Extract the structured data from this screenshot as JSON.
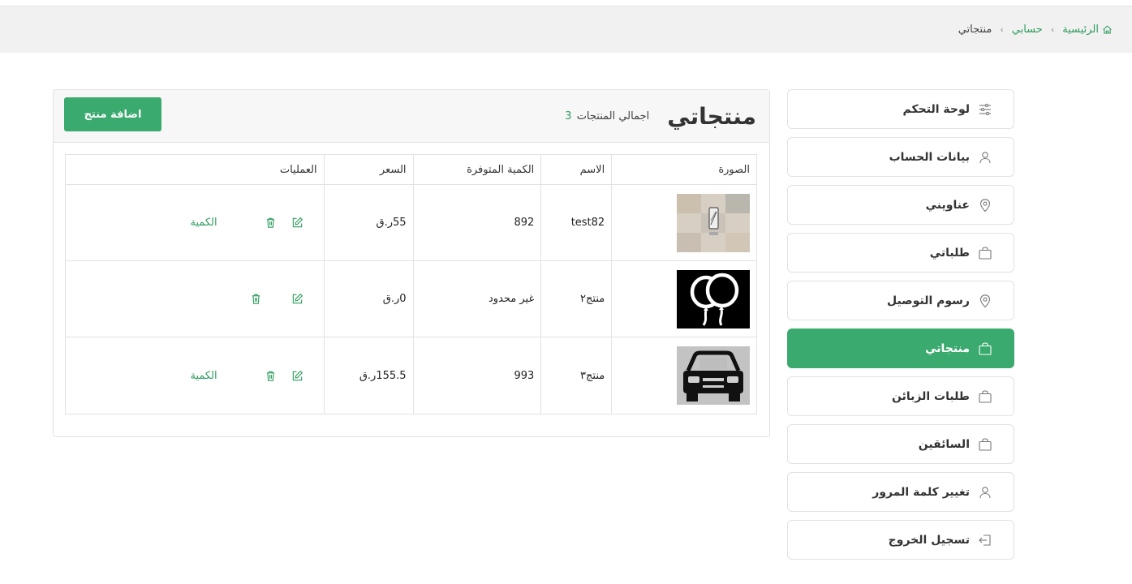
{
  "breadcrumb": {
    "home": "الرئيسية",
    "account": "حسابي",
    "current": "منتجاتي"
  },
  "sidebar": {
    "items": [
      {
        "label": "لوحة التحكم",
        "icon": "sliders-icon"
      },
      {
        "label": "بيانات الحساب",
        "icon": "user-icon"
      },
      {
        "label": "عناويني",
        "icon": "map-pin-icon"
      },
      {
        "label": "طلباتي",
        "icon": "bag-icon"
      },
      {
        "label": "رسوم التوصيل",
        "icon": "map-pin-icon"
      },
      {
        "label": "منتجاتي",
        "icon": "bag-icon",
        "active": true
      },
      {
        "label": "طلبات الزبائن",
        "icon": "bag-icon"
      },
      {
        "label": "السائقين",
        "icon": "bag-icon"
      },
      {
        "label": "تغيير كلمة المرور",
        "icon": "user-icon"
      },
      {
        "label": "تسجيل الخروج",
        "icon": "logout-icon"
      }
    ]
  },
  "main": {
    "title": "منتجاتي",
    "total_label": "اجمالي المنتجات",
    "total_count": "3",
    "add_button": "اضافة منتج",
    "columns": [
      "الصورة",
      "الاسم",
      "الكمية المتوفرة",
      "السعر",
      "العمليات"
    ],
    "rows": [
      {
        "image": "phone-thumbnail",
        "name": "test82",
        "qty": "892",
        "price": "55ر.ق",
        "qty_link": "الكمية"
      },
      {
        "image": "balloons-thumbnail",
        "name": "منتج٢",
        "qty": "غير محدود",
        "price": "0ر.ق",
        "qty_link": ""
      },
      {
        "image": "car-thumbnail",
        "name": "منتج٣",
        "qty": "993",
        "price": "155.5ر.ق",
        "qty_link": "الكمية"
      }
    ]
  },
  "colors": {
    "accent": "#3aaa6e",
    "link": "#2e9c5e",
    "border": "#e2e2e2",
    "header_bg": "#f1f1f1"
  }
}
